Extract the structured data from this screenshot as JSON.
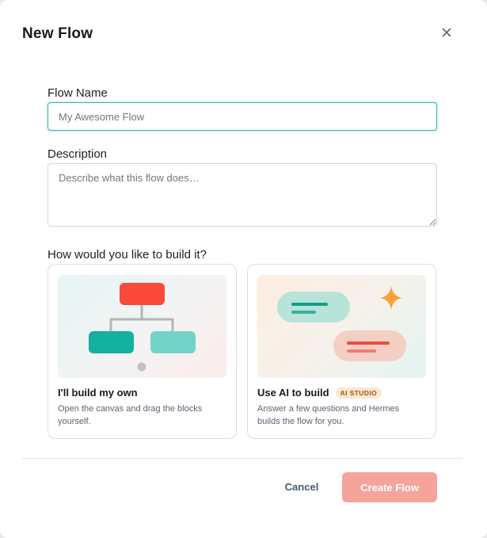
{
  "dialog": {
    "title": "New Flow",
    "close_icon": "close-icon"
  },
  "form": {
    "flow_name_label": "Flow Name",
    "flow_name_placeholder": "My Awesome Flow",
    "flow_name_value": "",
    "description_label": "Description",
    "description_placeholder": "Describe what this flow does…",
    "build_question": "How would you like to build it?"
  },
  "options": [
    {
      "title": "I'll build my own",
      "description": "Open the canvas and drag the blocks yourself.",
      "illustration_icon": "flowchart-icon"
    },
    {
      "title": "Use AI to build",
      "badge": "AI STUDIO",
      "description": "Answer a few questions and Hermes builds the flow for you.",
      "illustration_icon": "ai-chat-sparkle-icon"
    }
  ],
  "footer": {
    "cancel_label": "Cancel",
    "create_label": "Create Flow"
  },
  "colors": {
    "accent_teal": "#2fb3ad",
    "primary_button_disabled": "#f5a49c",
    "block_red": "#f94a3c",
    "block_teal": "#14b0a0",
    "sparkle_orange": "#f9a23a",
    "badge_bg": "#fde7cf"
  }
}
